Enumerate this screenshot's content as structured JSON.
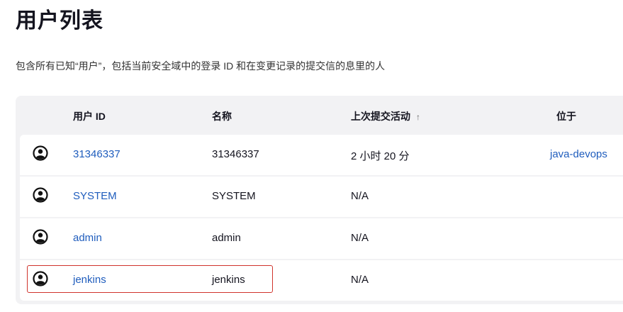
{
  "page": {
    "title": "用户列表",
    "description": "包含所有已知“用户”，包括当前安全域中的登录 ID 和在变更记录的提交信的息里的人"
  },
  "table": {
    "columns": {
      "user_id": "用户 ID",
      "name": "名称",
      "last_commit": "上次提交活动",
      "sort_indicator": "↑",
      "location": "位于"
    },
    "rows": [
      {
        "icon": "user-circle-icon",
        "user_id": "31346337",
        "name": "31346337",
        "last_commit": "2 小时 20 分",
        "location": "java-devops"
      },
      {
        "icon": "user-circle-icon",
        "user_id": "SYSTEM",
        "name": "SYSTEM",
        "last_commit": "N/A",
        "location": ""
      },
      {
        "icon": "user-circle-icon",
        "user_id": "admin",
        "name": "admin",
        "last_commit": "N/A",
        "location": ""
      },
      {
        "icon": "user-circle-icon",
        "user_id": "jenkins",
        "name": "jenkins",
        "last_commit": "N/A",
        "location": ""
      }
    ]
  },
  "colors": {
    "link": "#1f5dbd",
    "table_background": "#f2f2f4",
    "highlight_border": "#d0342c"
  }
}
